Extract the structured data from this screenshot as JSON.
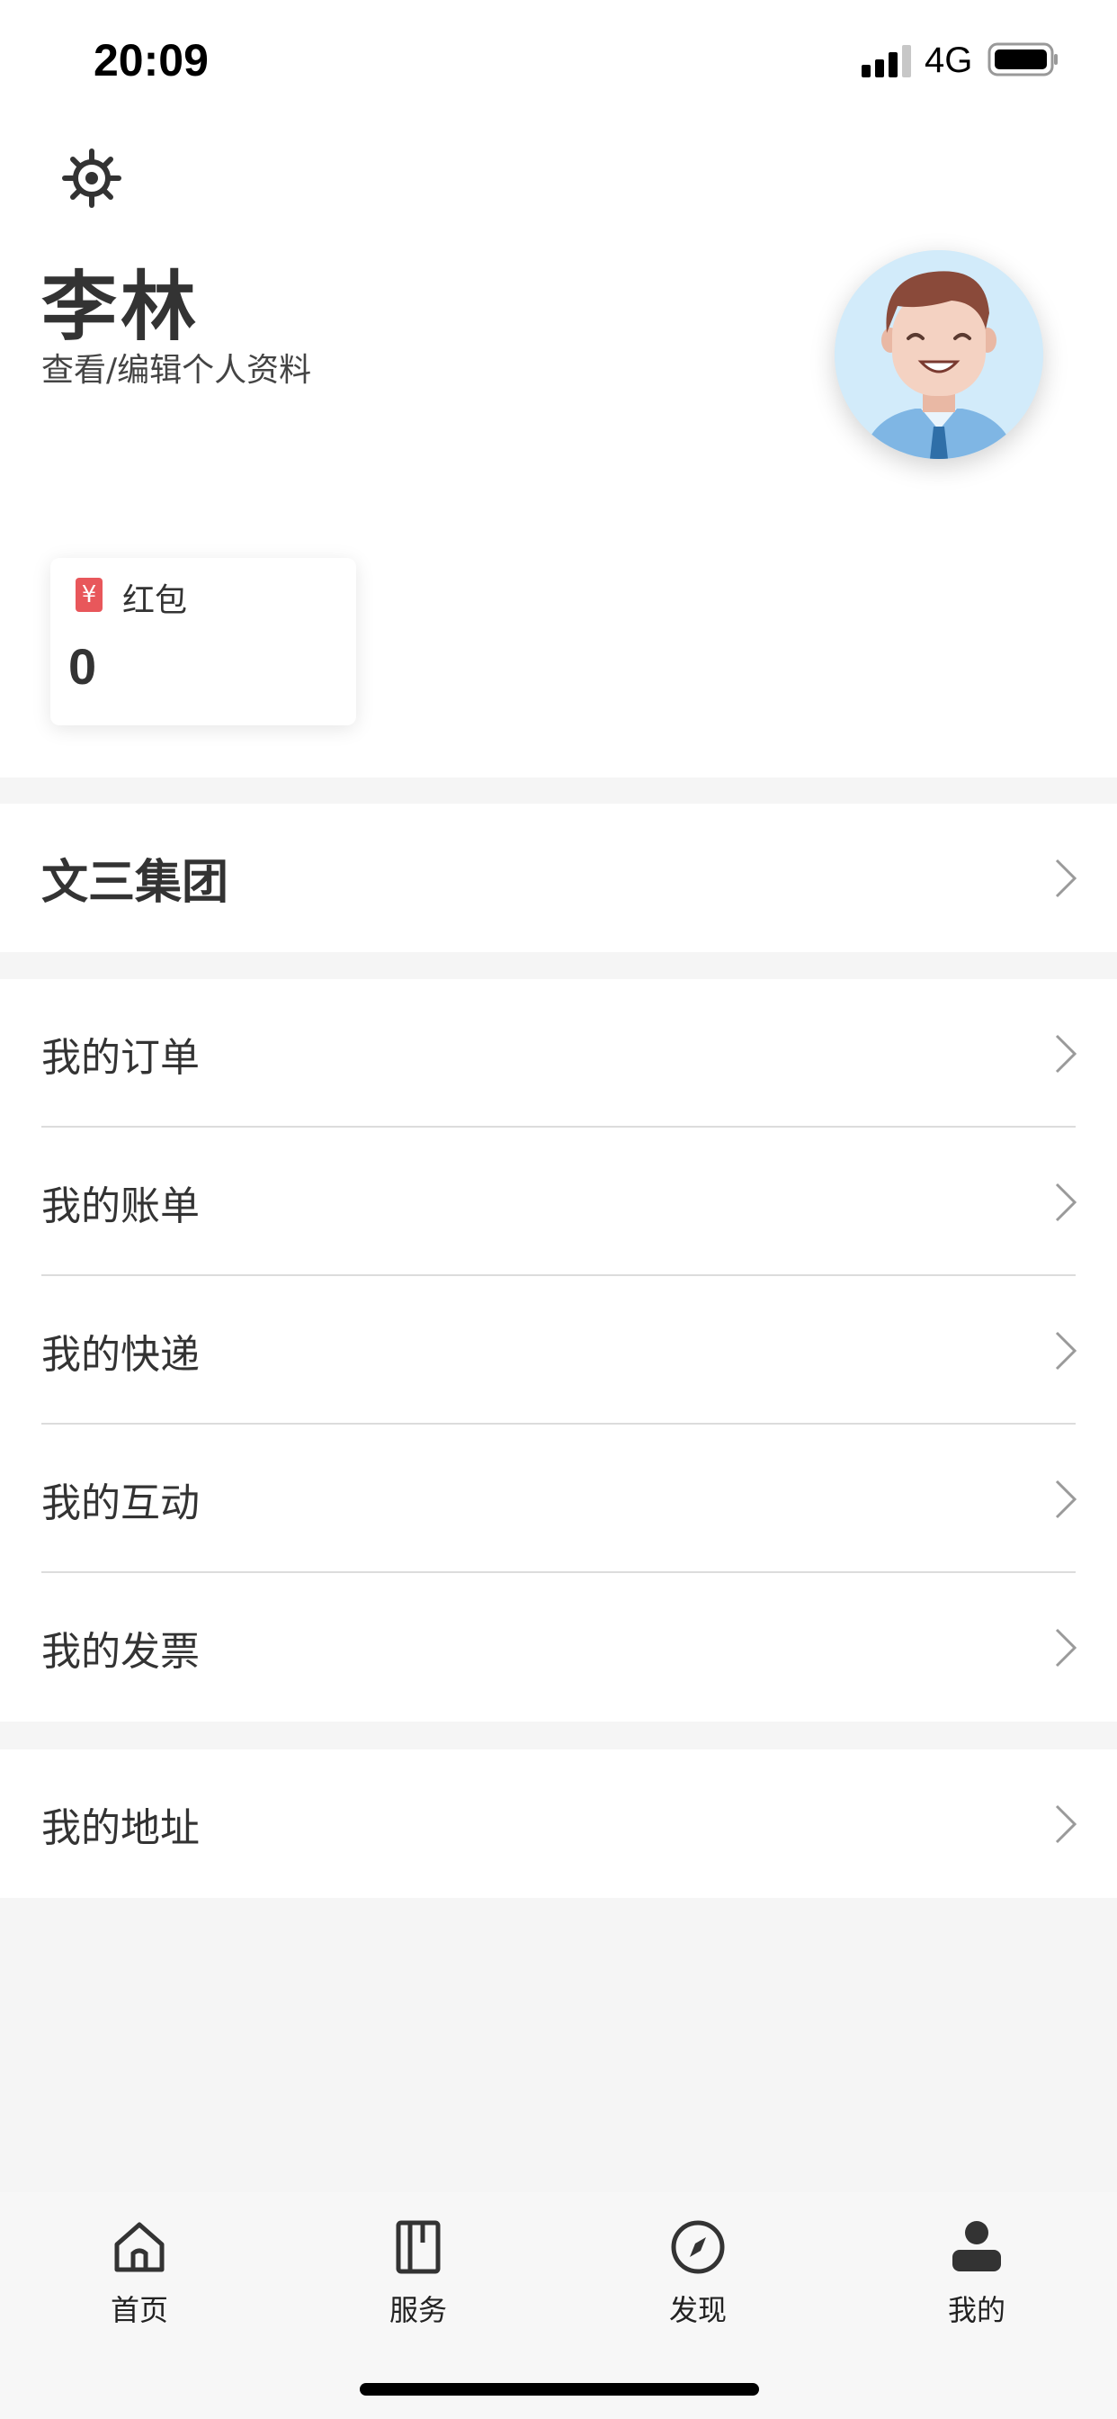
{
  "status_bar": {
    "time": "20:09",
    "network": "4G"
  },
  "profile": {
    "name": "李林",
    "edit_link": "查看/编辑个人资料",
    "hongbao": {
      "label": "红包",
      "icon_glyph": "¥",
      "value": "0"
    }
  },
  "company": {
    "label": "文三集团"
  },
  "menu": [
    {
      "label": "我的订单"
    },
    {
      "label": "我的账单"
    },
    {
      "label": "我的快递"
    },
    {
      "label": "我的互动"
    },
    {
      "label": "我的发票"
    }
  ],
  "address": {
    "label": "我的地址"
  },
  "tabbar": {
    "tabs": [
      {
        "label": "首页",
        "icon": "home-icon"
      },
      {
        "label": "服务",
        "icon": "book-icon"
      },
      {
        "label": "发现",
        "icon": "compass-icon"
      },
      {
        "label": "我的",
        "icon": "user-icon"
      }
    ]
  },
  "colors": {
    "accent_red": "#e8575b",
    "text": "#333333",
    "background": "#f5f5f5"
  }
}
